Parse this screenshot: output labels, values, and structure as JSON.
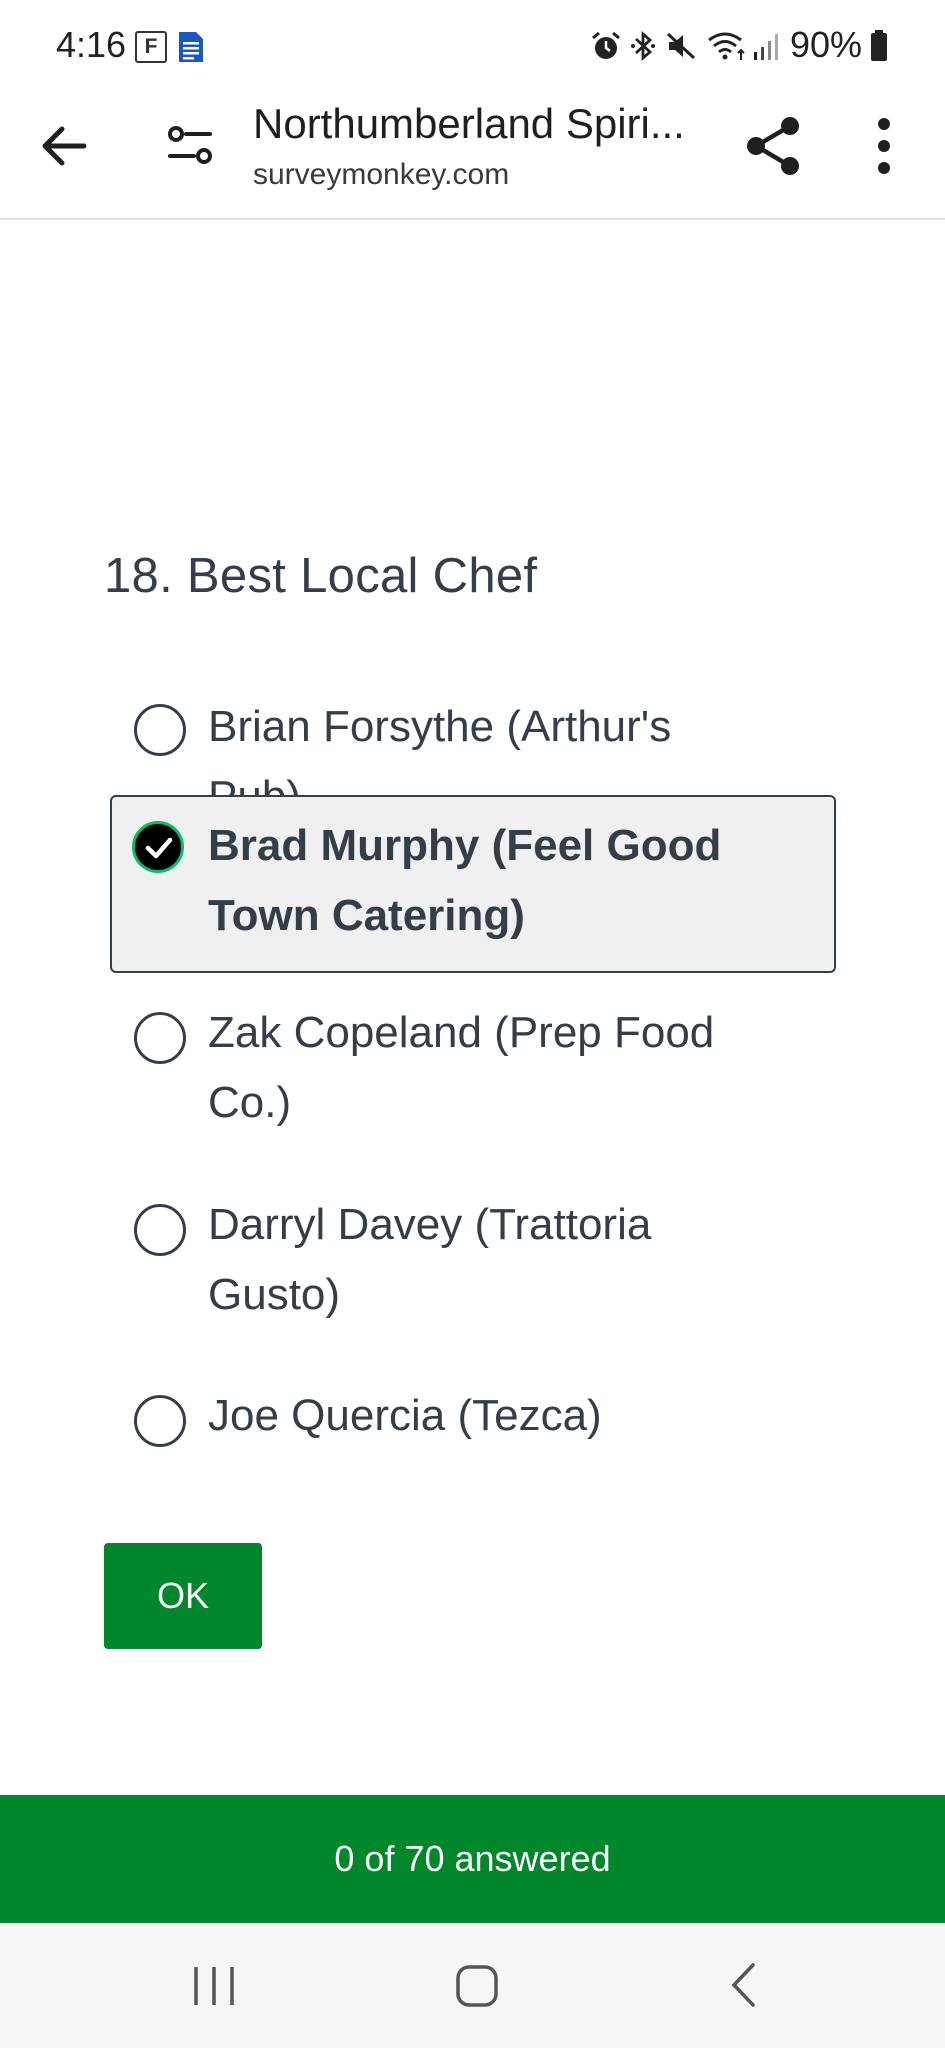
{
  "status_bar": {
    "time": "4:16",
    "f_badge": "F",
    "battery": "90%"
  },
  "browser": {
    "title": "Northumberland Spiri...",
    "domain": "surveymonkey.com"
  },
  "question": {
    "title": "18. Best Local Chef",
    "options": [
      {
        "label": "Brian Forsythe (Arthur's Pub)",
        "selected": false
      },
      {
        "label": "Brad Murphy (Feel Good Town Catering)",
        "selected": true
      },
      {
        "label": "Zak Copeland (Prep Food Co.)",
        "selected": false
      },
      {
        "label": "Darryl Davey (Trattoria Gusto)",
        "selected": false
      },
      {
        "label": "Joe Quercia (Tezca)",
        "selected": false
      }
    ]
  },
  "ok_button": "OK",
  "progress": {
    "text": "0 of 70 answered",
    "answered": 0,
    "total": 70
  },
  "colors": {
    "accent_green": "#00872b",
    "selected_ring": "#00bf6f",
    "text": "#333e48"
  }
}
